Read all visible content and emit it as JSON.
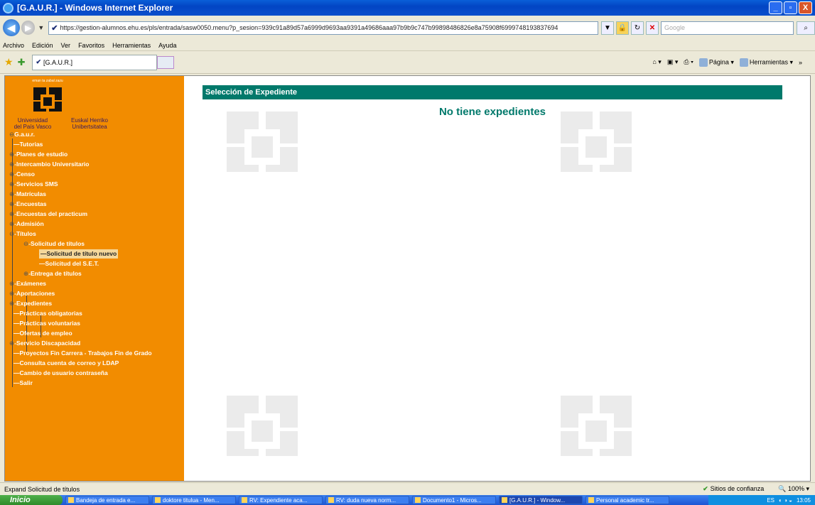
{
  "window": {
    "title": "[G.A.U.R.] - Windows Internet Explorer",
    "btn_min": "_",
    "btn_max": "▫",
    "btn_close": "X"
  },
  "address": {
    "url": "https://gestion-alumnos.ehu.es/pls/entrada/sasw0050.menu?p_sesion=939c91a89d57a6999d9693aa9391a49686aaa97b9b9c747b99898486826e8a75908f6999748193837694",
    "search_placeholder": "Google"
  },
  "menu": [
    "Archivo",
    "Edición",
    "Ver",
    "Favoritos",
    "Herramientas",
    "Ayuda"
  ],
  "tab": {
    "label": "[G.A.U.R.]"
  },
  "commandbar": {
    "page": "Página",
    "tools": "Herramientas",
    "more": "»"
  },
  "sidebar": {
    "motto": "eman ta zabal zazu",
    "uni_es": "Universidad\ndel País Vasco",
    "uni_eu": "Euskal Herriko\nUnibertsitatea",
    "root": "G.a.u.r.",
    "items": [
      {
        "label": "Tutorias",
        "toggle": ""
      },
      {
        "label": "Planes de estudio",
        "toggle": "⊕"
      },
      {
        "label": "Intercambio Universitario",
        "toggle": "⊕"
      },
      {
        "label": "Censo",
        "toggle": "⊕"
      },
      {
        "label": "Servicios SMS",
        "toggle": "⊕"
      },
      {
        "label": "Matrículas",
        "toggle": "⊕"
      },
      {
        "label": "Encuestas",
        "toggle": "⊕"
      },
      {
        "label": "Encuestas del practicum",
        "toggle": "⊕"
      },
      {
        "label": "Admisión",
        "toggle": "⊕"
      },
      {
        "label": "Títulos",
        "toggle": "⊖"
      },
      {
        "label": "Solicitud de títulos",
        "toggle": "⊖"
      },
      {
        "label": "Solicitud de título nuevo",
        "toggle": ""
      },
      {
        "label": "Solicitud del S.E.T.",
        "toggle": ""
      },
      {
        "label": "Entrega de títulos",
        "toggle": "⊕"
      },
      {
        "label": "Exámenes",
        "toggle": "⊕"
      },
      {
        "label": "Aportaciones",
        "toggle": "⊕"
      },
      {
        "label": "Expedientes",
        "toggle": "⊕"
      },
      {
        "label": "Prácticas obligatorias",
        "toggle": ""
      },
      {
        "label": "Prácticas voluntarias",
        "toggle": ""
      },
      {
        "label": "Ofertas de empleo",
        "toggle": ""
      },
      {
        "label": "Servicio Discapacidad",
        "toggle": "⊕"
      },
      {
        "label": "Proyectos Fin Carrera - Trabajos Fin de Grado",
        "toggle": ""
      },
      {
        "label": "Consulta cuenta de correo y LDAP",
        "toggle": ""
      },
      {
        "label": "Cambio de usuario contraseña",
        "toggle": ""
      },
      {
        "label": "Salir",
        "toggle": ""
      }
    ]
  },
  "main": {
    "header": "Selección de Expediente",
    "message": "No tiene expedientes"
  },
  "status": {
    "text": "Expand Solicitud de títulos",
    "zone": "Sitios de confianza",
    "zoom": "100%"
  },
  "taskbar": {
    "start": "Inicio",
    "items": [
      "Bandeja de entrada e...",
      "doktore titulua - Men...",
      "RV: Expendiente aca...",
      "RV: duda nueva norm...",
      "Documento1 - Micros...",
      "[G.A.U.R.] - Window...",
      "Personal academic tr..."
    ],
    "lang": "ES",
    "clock": "13:05"
  }
}
